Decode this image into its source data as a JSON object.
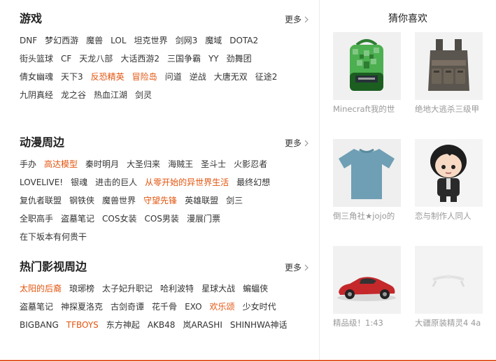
{
  "sections": [
    {
      "title": "游戏",
      "more": "更多",
      "rows": [
        [
          {
            "t": "DNF"
          },
          {
            "t": "梦幻西游"
          },
          {
            "t": "魔兽"
          },
          {
            "t": "LOL"
          },
          {
            "t": "坦克世界"
          },
          {
            "t": "剑网3"
          },
          {
            "t": "魔域"
          },
          {
            "t": "DOTA2"
          }
        ],
        [
          {
            "t": "街头篮球"
          },
          {
            "t": "CF"
          },
          {
            "t": "天龙八部"
          },
          {
            "t": "大话西游2"
          },
          {
            "t": "三国争霸"
          },
          {
            "t": "YY"
          },
          {
            "t": "劲舞团"
          }
        ],
        [
          {
            "t": "倩女幽魂"
          },
          {
            "t": "天下3"
          },
          {
            "t": "反恐精英",
            "hot": true
          },
          {
            "t": "冒险岛",
            "hot": true
          },
          {
            "t": "问道"
          },
          {
            "t": "逆战"
          },
          {
            "t": "大唐无双"
          },
          {
            "t": "征途2"
          }
        ],
        [
          {
            "t": "九阴真经"
          },
          {
            "t": "龙之谷"
          },
          {
            "t": "热血江湖"
          },
          {
            "t": "剑灵"
          }
        ]
      ]
    },
    {
      "title": "动漫周边",
      "more": "更多",
      "rows": [
        [
          {
            "t": "手办"
          },
          {
            "t": "高达模型",
            "hot": true
          },
          {
            "t": "秦时明月"
          },
          {
            "t": "大圣归来"
          },
          {
            "t": "海贼王"
          },
          {
            "t": "圣斗士"
          },
          {
            "t": "火影忍者"
          }
        ],
        [
          {
            "t": "LOVELIVE!"
          },
          {
            "t": "银魂"
          },
          {
            "t": "进击的巨人"
          },
          {
            "t": "从零开始的异世界生活",
            "hot": true
          },
          {
            "t": "最终幻想"
          }
        ],
        [
          {
            "t": "复仇者联盟"
          },
          {
            "t": "钢铁侠"
          },
          {
            "t": "魔兽世界"
          },
          {
            "t": "守望先锋",
            "hot": true
          },
          {
            "t": "英雄联盟"
          },
          {
            "t": "剑三"
          }
        ],
        [
          {
            "t": "全职高手"
          },
          {
            "t": "盗墓笔记"
          },
          {
            "t": "COS女装"
          },
          {
            "t": "COS男装"
          },
          {
            "t": "漫展门票"
          }
        ],
        [
          {
            "t": "在下坂本有何贵干"
          }
        ]
      ]
    },
    {
      "title": "热门影视周边",
      "more": "更多",
      "rows": [
        [
          {
            "t": "太阳的后裔",
            "hot": true
          },
          {
            "t": "琅琊榜"
          },
          {
            "t": "太子妃升职记"
          },
          {
            "t": "哈利波特"
          },
          {
            "t": "星球大战"
          },
          {
            "t": "蝙蝠侠"
          }
        ],
        [
          {
            "t": "盗墓笔记"
          },
          {
            "t": "神探夏洛克"
          },
          {
            "t": "古剑奇谭"
          },
          {
            "t": "花千骨"
          },
          {
            "t": "EXO"
          },
          {
            "t": "欢乐颂",
            "hot": true
          },
          {
            "t": "少女时代"
          }
        ],
        [
          {
            "t": "BIGBANG"
          },
          {
            "t": "TFBOYS",
            "hot": true
          },
          {
            "t": "东方神起"
          },
          {
            "t": "AKB48"
          },
          {
            "t": "岚ARASHI"
          },
          {
            "t": "SHINHWA神话"
          }
        ]
      ]
    }
  ],
  "guess": {
    "title": "猜你喜欢",
    "items": [
      {
        "name": "Minecraft我的世",
        "icon": "green-backpack-image"
      },
      {
        "name": "绝地大逃杀三级甲",
        "icon": "tactical-vest-image"
      },
      {
        "name": "倒三角社★jojo的",
        "icon": "blue-tshirt-image"
      },
      {
        "name": "恋与制作人同人",
        "icon": "chibi-doll-image"
      },
      {
        "name": "精品级！1:43",
        "icon": "red-model-car-image"
      },
      {
        "name": "大疆原装精灵4 4a",
        "icon": "white-drone-part-image"
      }
    ]
  },
  "colors": {
    "accent": "#e3540e",
    "bottom_line": "#e4572e",
    "link": "#333333",
    "product_name": "#999999"
  }
}
